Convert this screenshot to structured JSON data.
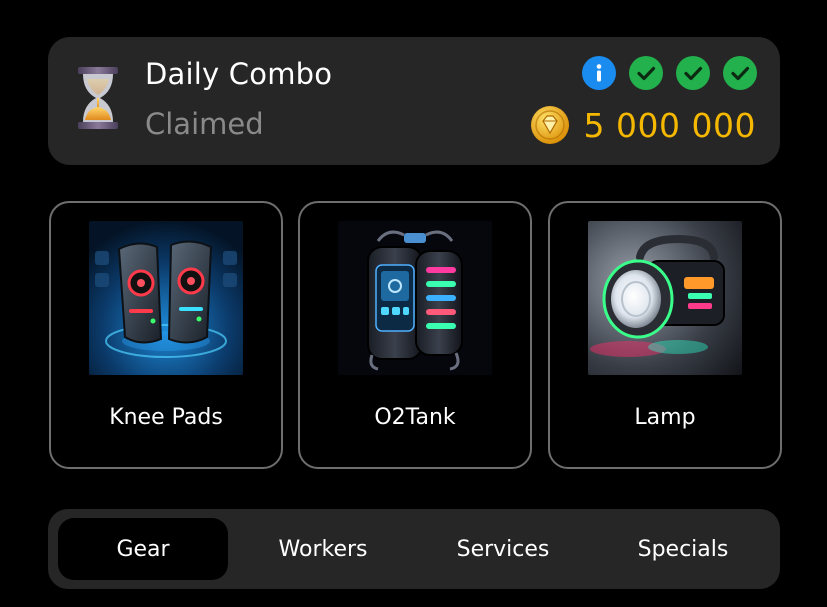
{
  "combo": {
    "title": "Daily Combo",
    "status": "Claimed",
    "reward": "5 000 000",
    "icon": "hourglass-icon",
    "badges": [
      "info-icon",
      "check-icon",
      "check-icon",
      "check-icon"
    ]
  },
  "cards": [
    {
      "label": "Knee Pads",
      "image": "knee-pads-image"
    },
    {
      "label": "O2Tank",
      "image": "oxygen-tank-image"
    },
    {
      "label": "Lamp",
      "image": "lamp-image"
    }
  ],
  "tabs": [
    {
      "label": "Gear",
      "active": true
    },
    {
      "label": "Workers",
      "active": false
    },
    {
      "label": "Services",
      "active": false
    },
    {
      "label": "Specials",
      "active": false
    }
  ],
  "colors": {
    "background": "#000000",
    "panel": "#262626",
    "reward": "#f5b800",
    "info": "#1a8cf0",
    "check": "#22b14c",
    "muted_text": "#8a8a8a"
  }
}
